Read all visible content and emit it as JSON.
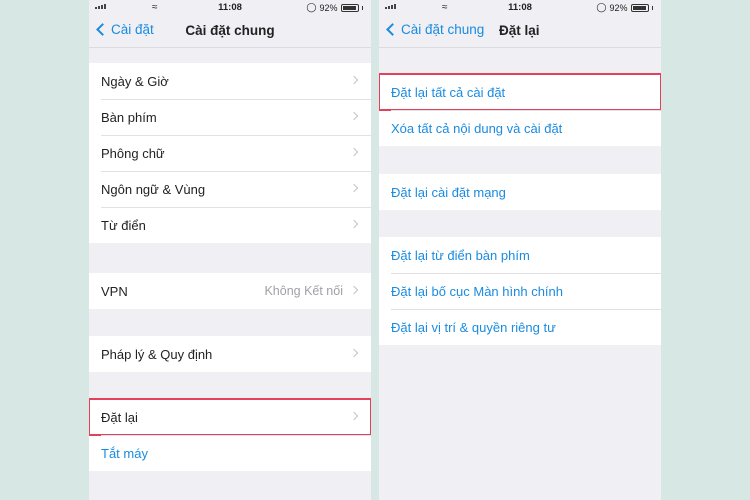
{
  "left": {
    "status": {
      "time": "11:08",
      "battery": "92%"
    },
    "nav": {
      "back_label": "Cài đặt",
      "title": "Cài đặt chung"
    },
    "group1": [
      "Ngày & Giờ",
      "Bàn phím",
      "Phông chữ",
      "Ngôn ngữ & Vùng",
      "Từ điển"
    ],
    "vpn": {
      "label": "VPN",
      "detail": "Không Kết nối"
    },
    "legal": "Pháp lý & Quy định",
    "reset": "Đặt lại",
    "shutdown": "Tắt máy"
  },
  "right": {
    "status": {
      "time": "11:08",
      "battery": "92%"
    },
    "nav": {
      "back_label": "Cài đặt chung",
      "title": "Đặt lại"
    },
    "group1": [
      "Đặt lại tất cả cài đặt",
      "Xóa tất cả nội dung và cài đặt"
    ],
    "group2": [
      "Đặt lại cài đặt mạng"
    ],
    "group3": [
      "Đặt lại từ điển bàn phím",
      "Đặt lại bố cục Màn hình chính",
      "Đặt lại vị trí & quyền riêng tư"
    ]
  },
  "colors": {
    "accent": "#1a8be0",
    "highlight": "#e2405b",
    "background": "#d6e7e4"
  }
}
